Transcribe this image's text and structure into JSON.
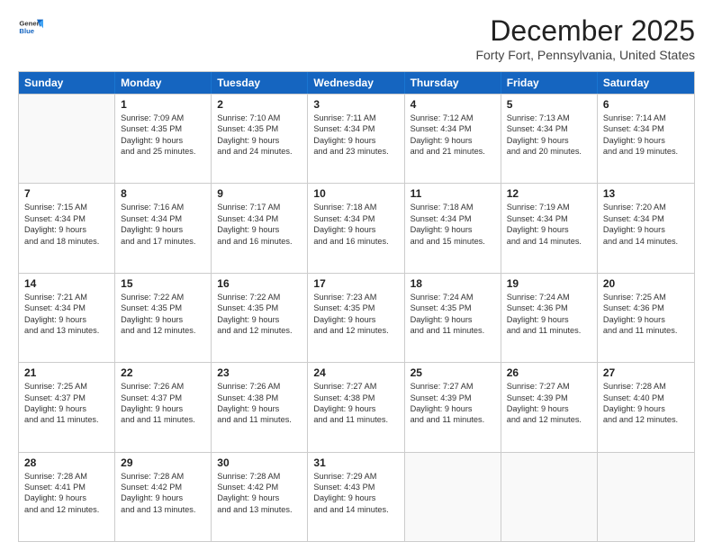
{
  "header": {
    "logo": {
      "general": "General",
      "blue": "Blue"
    },
    "title": "December 2025",
    "subtitle": "Forty Fort, Pennsylvania, United States"
  },
  "days": [
    "Sunday",
    "Monday",
    "Tuesday",
    "Wednesday",
    "Thursday",
    "Friday",
    "Saturday"
  ],
  "weeks": [
    [
      {
        "day": "",
        "sunrise": "",
        "sunset": "",
        "daylight": ""
      },
      {
        "day": "1",
        "sunrise": "Sunrise: 7:09 AM",
        "sunset": "Sunset: 4:35 PM",
        "daylight": "Daylight: 9 hours and 25 minutes."
      },
      {
        "day": "2",
        "sunrise": "Sunrise: 7:10 AM",
        "sunset": "Sunset: 4:35 PM",
        "daylight": "Daylight: 9 hours and 24 minutes."
      },
      {
        "day": "3",
        "sunrise": "Sunrise: 7:11 AM",
        "sunset": "Sunset: 4:34 PM",
        "daylight": "Daylight: 9 hours and 23 minutes."
      },
      {
        "day": "4",
        "sunrise": "Sunrise: 7:12 AM",
        "sunset": "Sunset: 4:34 PM",
        "daylight": "Daylight: 9 hours and 21 minutes."
      },
      {
        "day": "5",
        "sunrise": "Sunrise: 7:13 AM",
        "sunset": "Sunset: 4:34 PM",
        "daylight": "Daylight: 9 hours and 20 minutes."
      },
      {
        "day": "6",
        "sunrise": "Sunrise: 7:14 AM",
        "sunset": "Sunset: 4:34 PM",
        "daylight": "Daylight: 9 hours and 19 minutes."
      }
    ],
    [
      {
        "day": "7",
        "sunrise": "Sunrise: 7:15 AM",
        "sunset": "Sunset: 4:34 PM",
        "daylight": "Daylight: 9 hours and 18 minutes."
      },
      {
        "day": "8",
        "sunrise": "Sunrise: 7:16 AM",
        "sunset": "Sunset: 4:34 PM",
        "daylight": "Daylight: 9 hours and 17 minutes."
      },
      {
        "day": "9",
        "sunrise": "Sunrise: 7:17 AM",
        "sunset": "Sunset: 4:34 PM",
        "daylight": "Daylight: 9 hours and 16 minutes."
      },
      {
        "day": "10",
        "sunrise": "Sunrise: 7:18 AM",
        "sunset": "Sunset: 4:34 PM",
        "daylight": "Daylight: 9 hours and 16 minutes."
      },
      {
        "day": "11",
        "sunrise": "Sunrise: 7:18 AM",
        "sunset": "Sunset: 4:34 PM",
        "daylight": "Daylight: 9 hours and 15 minutes."
      },
      {
        "day": "12",
        "sunrise": "Sunrise: 7:19 AM",
        "sunset": "Sunset: 4:34 PM",
        "daylight": "Daylight: 9 hours and 14 minutes."
      },
      {
        "day": "13",
        "sunrise": "Sunrise: 7:20 AM",
        "sunset": "Sunset: 4:34 PM",
        "daylight": "Daylight: 9 hours and 14 minutes."
      }
    ],
    [
      {
        "day": "14",
        "sunrise": "Sunrise: 7:21 AM",
        "sunset": "Sunset: 4:34 PM",
        "daylight": "Daylight: 9 hours and 13 minutes."
      },
      {
        "day": "15",
        "sunrise": "Sunrise: 7:22 AM",
        "sunset": "Sunset: 4:35 PM",
        "daylight": "Daylight: 9 hours and 12 minutes."
      },
      {
        "day": "16",
        "sunrise": "Sunrise: 7:22 AM",
        "sunset": "Sunset: 4:35 PM",
        "daylight": "Daylight: 9 hours and 12 minutes."
      },
      {
        "day": "17",
        "sunrise": "Sunrise: 7:23 AM",
        "sunset": "Sunset: 4:35 PM",
        "daylight": "Daylight: 9 hours and 12 minutes."
      },
      {
        "day": "18",
        "sunrise": "Sunrise: 7:24 AM",
        "sunset": "Sunset: 4:35 PM",
        "daylight": "Daylight: 9 hours and 11 minutes."
      },
      {
        "day": "19",
        "sunrise": "Sunrise: 7:24 AM",
        "sunset": "Sunset: 4:36 PM",
        "daylight": "Daylight: 9 hours and 11 minutes."
      },
      {
        "day": "20",
        "sunrise": "Sunrise: 7:25 AM",
        "sunset": "Sunset: 4:36 PM",
        "daylight": "Daylight: 9 hours and 11 minutes."
      }
    ],
    [
      {
        "day": "21",
        "sunrise": "Sunrise: 7:25 AM",
        "sunset": "Sunset: 4:37 PM",
        "daylight": "Daylight: 9 hours and 11 minutes."
      },
      {
        "day": "22",
        "sunrise": "Sunrise: 7:26 AM",
        "sunset": "Sunset: 4:37 PM",
        "daylight": "Daylight: 9 hours and 11 minutes."
      },
      {
        "day": "23",
        "sunrise": "Sunrise: 7:26 AM",
        "sunset": "Sunset: 4:38 PM",
        "daylight": "Daylight: 9 hours and 11 minutes."
      },
      {
        "day": "24",
        "sunrise": "Sunrise: 7:27 AM",
        "sunset": "Sunset: 4:38 PM",
        "daylight": "Daylight: 9 hours and 11 minutes."
      },
      {
        "day": "25",
        "sunrise": "Sunrise: 7:27 AM",
        "sunset": "Sunset: 4:39 PM",
        "daylight": "Daylight: 9 hours and 11 minutes."
      },
      {
        "day": "26",
        "sunrise": "Sunrise: 7:27 AM",
        "sunset": "Sunset: 4:39 PM",
        "daylight": "Daylight: 9 hours and 12 minutes."
      },
      {
        "day": "27",
        "sunrise": "Sunrise: 7:28 AM",
        "sunset": "Sunset: 4:40 PM",
        "daylight": "Daylight: 9 hours and 12 minutes."
      }
    ],
    [
      {
        "day": "28",
        "sunrise": "Sunrise: 7:28 AM",
        "sunset": "Sunset: 4:41 PM",
        "daylight": "Daylight: 9 hours and 12 minutes."
      },
      {
        "day": "29",
        "sunrise": "Sunrise: 7:28 AM",
        "sunset": "Sunset: 4:42 PM",
        "daylight": "Daylight: 9 hours and 13 minutes."
      },
      {
        "day": "30",
        "sunrise": "Sunrise: 7:28 AM",
        "sunset": "Sunset: 4:42 PM",
        "daylight": "Daylight: 9 hours and 13 minutes."
      },
      {
        "day": "31",
        "sunrise": "Sunrise: 7:29 AM",
        "sunset": "Sunset: 4:43 PM",
        "daylight": "Daylight: 9 hours and 14 minutes."
      },
      {
        "day": "",
        "sunrise": "",
        "sunset": "",
        "daylight": ""
      },
      {
        "day": "",
        "sunrise": "",
        "sunset": "",
        "daylight": ""
      },
      {
        "day": "",
        "sunrise": "",
        "sunset": "",
        "daylight": ""
      }
    ]
  ]
}
